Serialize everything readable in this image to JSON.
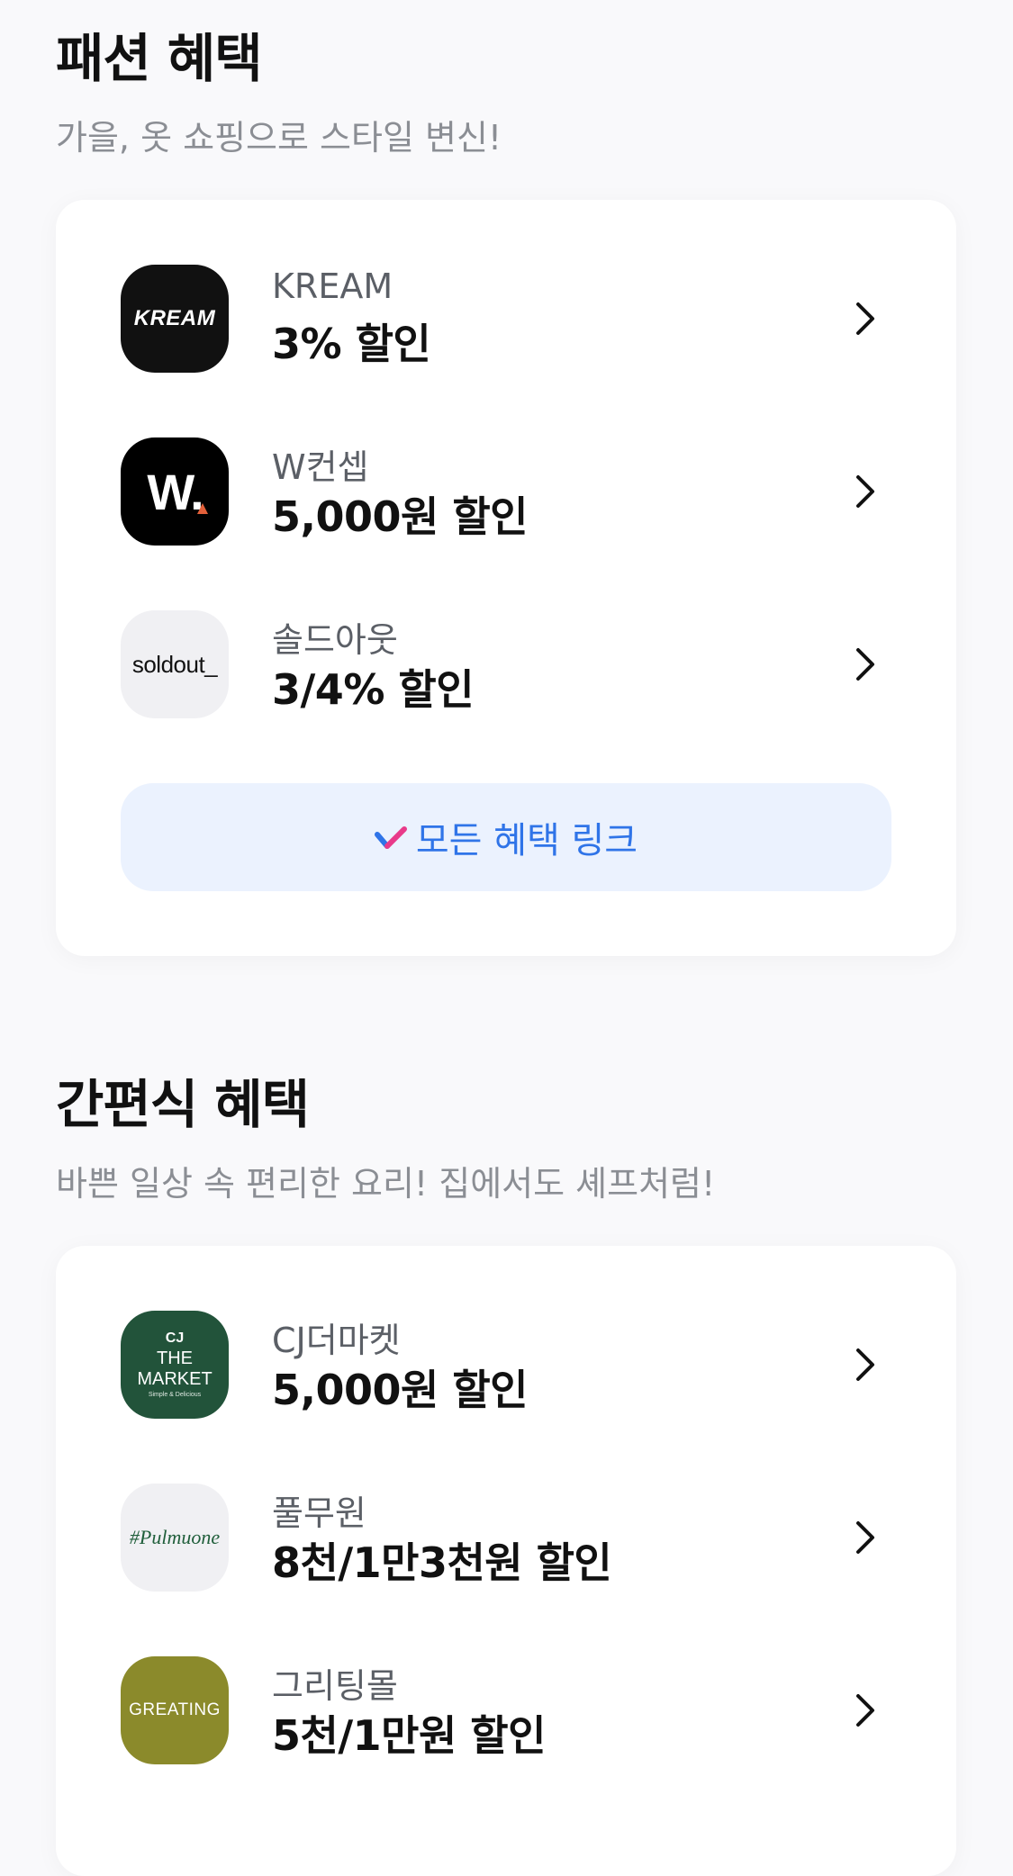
{
  "fashion": {
    "title": "패션 혜택",
    "subtitle": "가을, 옷 쇼핑으로 스타일 변신!",
    "items": [
      {
        "brand": "KREAM",
        "offer": "3% 할인",
        "logo_text": "KREAM",
        "logo_bg": "#111111"
      },
      {
        "brand": "W컨셉",
        "offer": "5,000원 할인",
        "logo_text": "W.",
        "logo_bg": "#000000"
      },
      {
        "brand": "솔드아웃",
        "offer": "3/4% 할인",
        "logo_text": "soldout_",
        "logo_bg": "#f0f0f3"
      }
    ],
    "all_button_label": "모든 혜택 링크"
  },
  "meal_kit": {
    "title": "간편식 혜택",
    "subtitle": "바쁜 일상 속 편리한 요리! 집에서도 셰프처럼!",
    "items": [
      {
        "brand": "CJ더마켓",
        "offer": "5,000원 할인",
        "logo_lines": [
          "CJ",
          "THE",
          "MARKET",
          "Simple & Delicious"
        ],
        "logo_bg": "#22533a"
      },
      {
        "brand": "풀무원",
        "offer": "8천/1만3천원 할인",
        "logo_text": "#Pulmuone",
        "logo_bg": "#f0f0f3"
      },
      {
        "brand": "그리팅몰",
        "offer": "5천/1만원 할인",
        "logo_text": "GREATING",
        "logo_bg": "#8b8a2b"
      }
    ]
  },
  "colors": {
    "accent_blue": "#2f74e8",
    "button_bg": "#ebf2fe",
    "subtitle_gray": "#8b8e94",
    "page_bg": "#f9f9fb"
  },
  "icons": {
    "row_chevron": "chevron-right-icon",
    "button_mark": "check-mark-icon"
  }
}
